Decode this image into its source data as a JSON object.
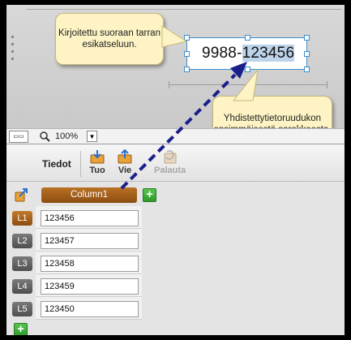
{
  "preview": {
    "label_prefix": "9988-",
    "label_highlight": "123456",
    "callout_typed": "Kirjoitettu suoraan tarran esikatseluun.",
    "callout_merged": "Yhdistettytietoruudukon ensimmäisestä sarakkeesta."
  },
  "zoombar": {
    "zoom_value": "100%",
    "fit_icon": "fit-page-icon",
    "magnifier_icon": "magnifier-icon",
    "dropdown_icon": "chevron-down-icon"
  },
  "toolbar": {
    "title": "Tiedot",
    "import_label": "Tuo",
    "export_label": "Vie",
    "restore_label": "Palauta"
  },
  "grid": {
    "column_header": "Column1",
    "add_column_icon": "plus-icon",
    "add_row_icon": "plus-icon",
    "rows": [
      {
        "tag": "L1",
        "value": "123456",
        "active": true
      },
      {
        "tag": "L2",
        "value": "123457",
        "active": false
      },
      {
        "tag": "L3",
        "value": "123458",
        "active": false
      },
      {
        "tag": "L4",
        "value": "123459",
        "active": false
      },
      {
        "tag": "L5",
        "value": "123450",
        "active": false
      }
    ]
  },
  "colors": {
    "accent_brown": "#a5611b",
    "arrow_blue": "#1a1f8a",
    "callout_bg": "#fdf3c4",
    "add_green": "#3aaa35"
  }
}
